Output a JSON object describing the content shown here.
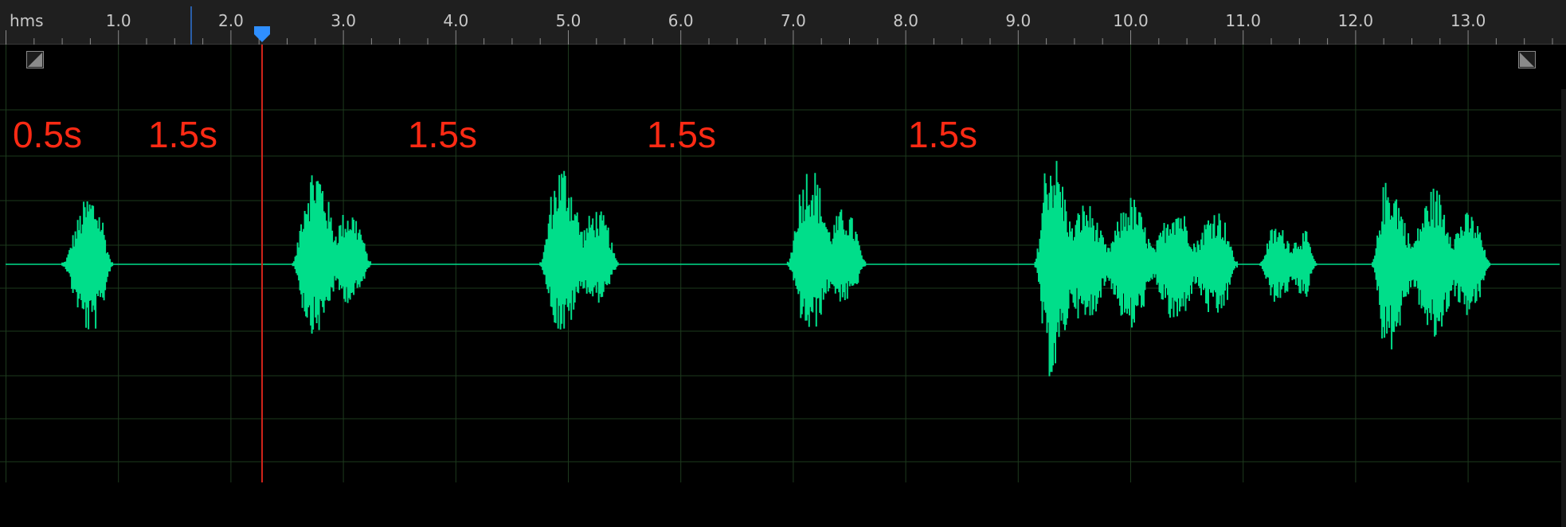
{
  "ruler": {
    "units_label": "hms",
    "tick_labels": [
      "1.0",
      "2.0",
      "3.0",
      "4.0",
      "5.0",
      "6.0",
      "7.0",
      "8.0",
      "9.0",
      "10.0",
      "11.0",
      "12.0",
      "13.0"
    ]
  },
  "playhead": {
    "time_seconds": 2.28,
    "label": ""
  },
  "selection_marker": {
    "time_seconds": 1.64
  },
  "annotations": [
    "0.5s",
    "1.5s",
    "1.5s",
    "1.5s",
    "1.5s"
  ],
  "colors": {
    "waveform": "#00de8a",
    "playhead": "#d0231a",
    "annotation": "#ff2a14",
    "playhead_handle": "#2f8fff",
    "background": "#000000",
    "ruler_bg": "#1f1f1f"
  },
  "icons": {
    "zoom_left": "zoom-corner-icon",
    "zoom_right": "zoom-corner-icon"
  }
}
